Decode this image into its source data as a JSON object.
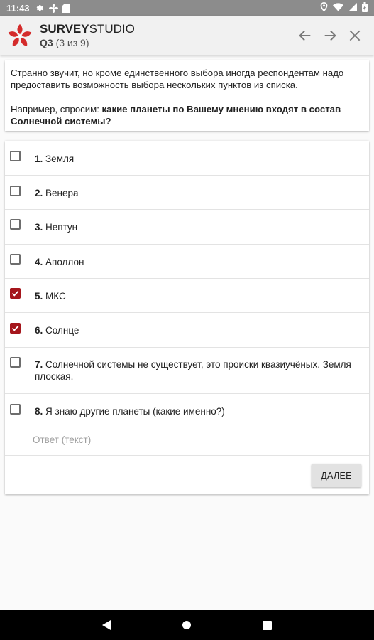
{
  "status_bar": {
    "time": "11:43",
    "left_icons": [
      "settings-icon",
      "fan-icon",
      "sd-card-icon"
    ],
    "right_icons": [
      "location-icon",
      "wifi-icon",
      "signal-icon",
      "battery-icon"
    ]
  },
  "app_bar": {
    "brand_bold": "SURVEY",
    "brand_light": "STUDIO",
    "question_code": "Q3",
    "question_progress": "(3 из 9)",
    "nav_icons": [
      "arrow-back-icon",
      "arrow-forward-icon",
      "close-icon"
    ]
  },
  "question": {
    "paragraph1": "Странно звучит, но кроме единственного выбора иногда респондентам надо предоставить возможность выбора нескольких пунктов из списка.",
    "paragraph2_prefix": "Например, спросим: ",
    "paragraph2_bold": "какие планеты по Вашему мнению входят в состав Солнечной системы?"
  },
  "options": [
    {
      "number": "1.",
      "text": "Земля",
      "checked": false
    },
    {
      "number": "2.",
      "text": "Венера",
      "checked": false
    },
    {
      "number": "3.",
      "text": "Нептун",
      "checked": false
    },
    {
      "number": "4.",
      "text": "Аполлон",
      "checked": false
    },
    {
      "number": "5.",
      "text": "МКС",
      "checked": true
    },
    {
      "number": "6.",
      "text": "Солнце",
      "checked": true
    },
    {
      "number": "7.",
      "text": "Солнечной системы не существует, это происки квазиучёных. Земля плоская.",
      "checked": false
    },
    {
      "number": "8.",
      "text": "Я знаю другие планеты (какие именно?)",
      "checked": false
    }
  ],
  "answer_field": {
    "placeholder": "Ответ (текст)",
    "value": ""
  },
  "next_button": {
    "label": "ДАЛЕЕ"
  },
  "colors": {
    "accent": "#a5161c",
    "app_bar": "#f1f1f1",
    "status_bar": "#8c8c8c"
  }
}
